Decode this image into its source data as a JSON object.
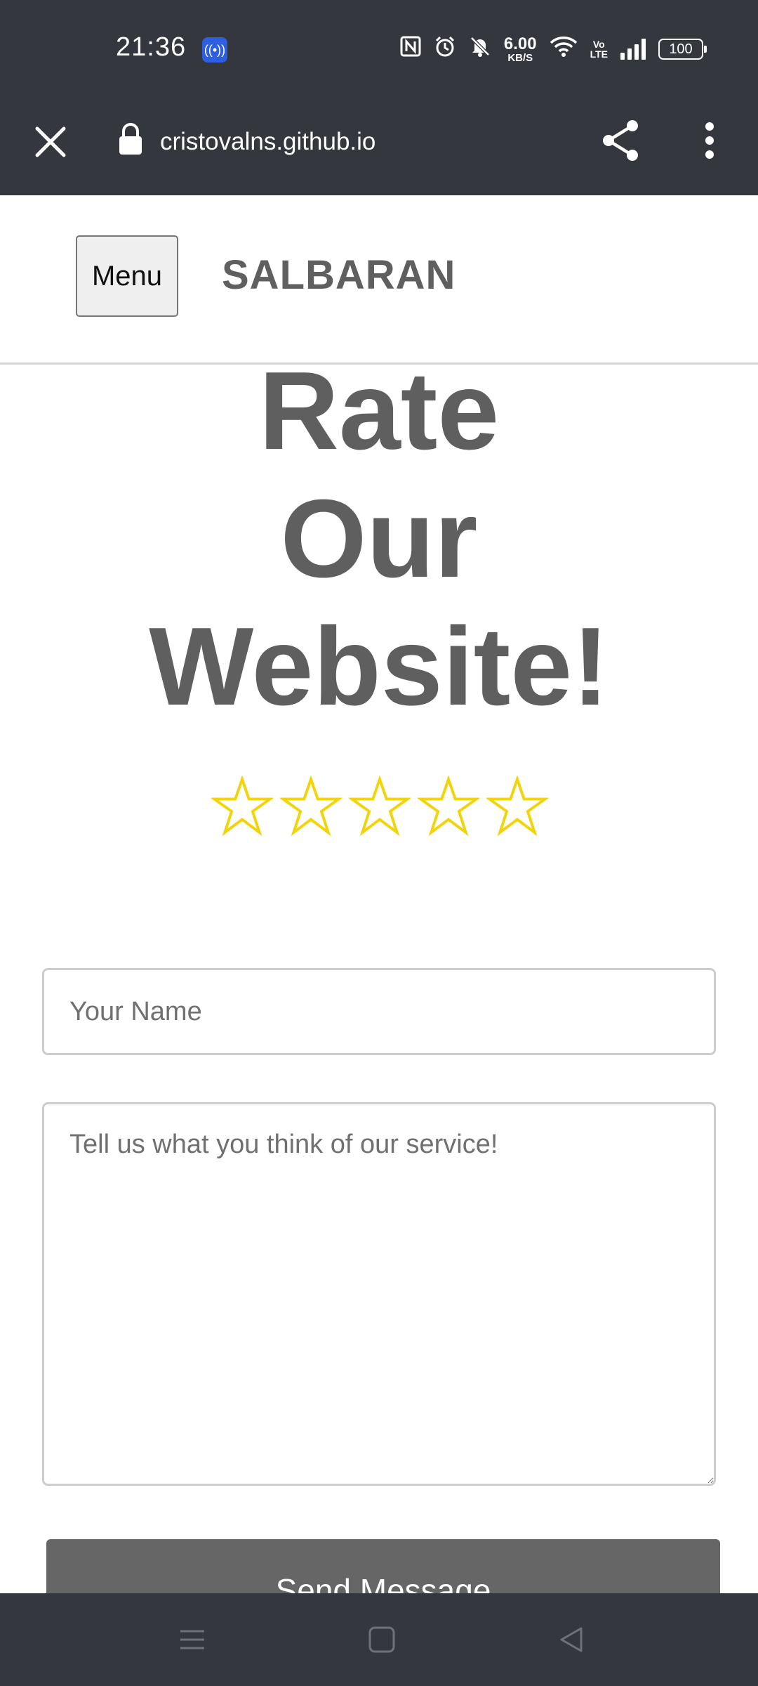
{
  "status_bar": {
    "time": "21:36",
    "app_icon": "broadcast-icon",
    "icons": [
      "nfc-icon",
      "alarm-icon",
      "mute-icon",
      "wifi-icon",
      "volte-icon",
      "signal-icon",
      "battery-icon"
    ],
    "network_speed": "6.00",
    "network_speed_unit": "KB/S",
    "volte_top": "Vo",
    "volte_bottom": "LTE",
    "battery_level": "100"
  },
  "browser": {
    "url": "cristovalns.github.io",
    "close_icon": "close-icon",
    "lock_icon": "lock-icon",
    "share_icon": "share-icon",
    "more_icon": "more-vertical-icon"
  },
  "header": {
    "menu_label": "Menu",
    "brand": "SALBARAN"
  },
  "hero": {
    "line1": "Rate",
    "line2": "Our",
    "line3": "Website!"
  },
  "rating": {
    "max_stars": 5,
    "selected": 0,
    "star_color": "#f2d40c"
  },
  "form": {
    "name_placeholder": "Your Name",
    "message_placeholder": "Tell us what you think of our service!",
    "submit_label": "Send Message"
  },
  "nav_bar": {
    "icons": [
      "menu-lines-icon",
      "home-square-icon",
      "back-triangle-icon"
    ]
  }
}
